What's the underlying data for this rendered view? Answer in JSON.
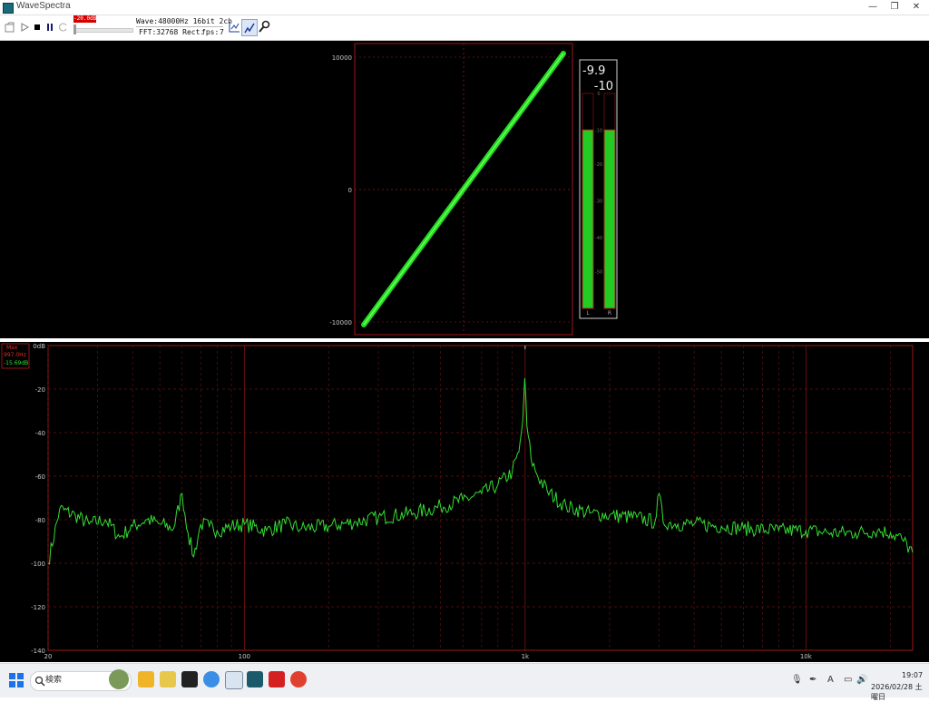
{
  "window": {
    "title": "WaveSpectra",
    "minimize": "—",
    "restore": "❐",
    "close": "✕"
  },
  "toolbar": {
    "level_indicator": "-20.0dB",
    "wave_info": "Wave:48000Hz 16bit 2ch",
    "fft_info": "FFT:32768 Rect.",
    "fps_label": "fps:",
    "fps_value": "7"
  },
  "lissajous": {
    "y_ticks": [
      "10000",
      "0",
      "-10000"
    ]
  },
  "meter": {
    "left_db": "-9.9",
    "right_db": "-10",
    "ch_left": "L",
    "ch_right": "R",
    "level_fraction": 0.83,
    "scale": [
      {
        "label": "0",
        "frac": 0.0
      },
      {
        "label": "-10",
        "frac": 0.17
      },
      {
        "label": "-20",
        "frac": 0.33
      },
      {
        "label": "-30",
        "frac": 0.5
      },
      {
        "label": "-40",
        "frac": 0.67
      },
      {
        "label": "-50",
        "frac": 0.83
      }
    ]
  },
  "spectrum": {
    "mode_label": "Max",
    "freq_readout": "997.0Hz",
    "level_readout": "-15.69dB",
    "y_labels": [
      "0dB",
      "-20",
      "-40",
      "-60",
      "-80",
      "-100",
      "-120",
      "-140"
    ],
    "x_labels": [
      {
        "label": "20",
        "hz": 20
      },
      {
        "label": "100",
        "hz": 100
      },
      {
        "label": "1k",
        "hz": 1000
      },
      {
        "label": "10k",
        "hz": 10000
      }
    ]
  },
  "chart_data": {
    "type": "line",
    "xscale": "log",
    "xlim": [
      20,
      24000
    ],
    "ylim": [
      -140,
      0
    ],
    "grid": true,
    "series": [
      {
        "x": [
          20,
          22,
          25,
          28,
          32,
          36,
          40,
          45,
          50,
          56,
          60,
          63,
          66,
          70,
          75,
          80,
          90,
          100,
          120,
          140,
          160,
          200,
          250,
          300,
          400,
          500,
          600,
          700,
          800,
          900,
          950,
          980,
          997,
          1015,
          1050,
          1100,
          1200,
          1400,
          1700,
          2000,
          2500,
          2900,
          3000,
          3100,
          3500,
          4000,
          5000,
          6000,
          8000,
          10000,
          12000,
          15000,
          18000,
          20000,
          22000,
          24000
        ],
        "y": [
          -100,
          -75,
          -78,
          -82,
          -80,
          -88,
          -83,
          -80,
          -82,
          -84,
          -68,
          -86,
          -97,
          -82,
          -83,
          -85,
          -83,
          -82,
          -85,
          -82,
          -84,
          -83,
          -81,
          -79,
          -77,
          -74,
          -71,
          -68,
          -64,
          -58,
          -49,
          -35,
          -15,
          -37,
          -52,
          -59,
          -67,
          -74,
          -77,
          -78,
          -79,
          -81,
          -68,
          -81,
          -82,
          -82,
          -83,
          -84,
          -85,
          -85,
          -86,
          -86,
          -85,
          -86,
          -89,
          -95
        ]
      }
    ]
  },
  "taskbar": {
    "search_placeholder": "検索",
    "time": "19:07",
    "date": "2026/02/28 土曜日"
  }
}
